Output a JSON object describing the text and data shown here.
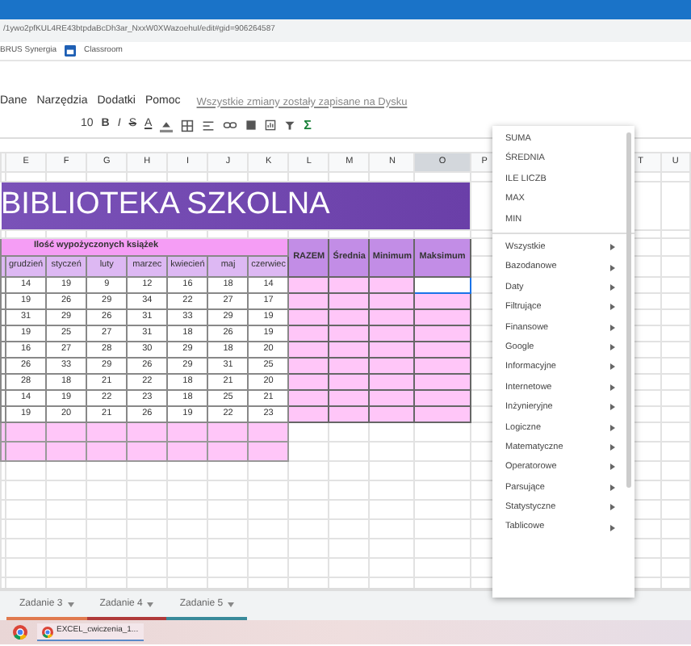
{
  "browser": {
    "url": "/1ywo2pfKUL4RE43btpdaBcDh3ar_NxxW0XWazoehuI/edit#gid=906264587",
    "bookmarks": [
      "BRUS Synergia",
      "Classroom"
    ]
  },
  "menu_bar": {
    "items": [
      "Dane",
      "Narzędzia",
      "Dodatki",
      "Pomoc"
    ],
    "save_status": "Wszystkie zmiany zostały zapisane na Dysku"
  },
  "toolbar": {
    "font_size": "10",
    "formatting": [
      "B",
      "I",
      "S",
      "A"
    ],
    "function_symbol": "Σ"
  },
  "columns": [
    {
      "letter": "E",
      "selected": false
    },
    {
      "letter": "F",
      "selected": false
    },
    {
      "letter": "G",
      "selected": false
    },
    {
      "letter": "H",
      "selected": false
    },
    {
      "letter": "I",
      "selected": false
    },
    {
      "letter": "J",
      "selected": false
    },
    {
      "letter": "K",
      "selected": false
    },
    {
      "letter": "L",
      "selected": false
    },
    {
      "letter": "M",
      "selected": false
    },
    {
      "letter": "N",
      "selected": false
    },
    {
      "letter": "O",
      "selected": true
    },
    {
      "letter": "P",
      "selected": false
    }
  ],
  "right_columns": [
    {
      "letter": "T",
      "selected": false
    },
    {
      "letter": "U",
      "selected": false
    }
  ],
  "sheet": {
    "title": "BIBLIOTEKA SZKOLNA",
    "group_header": "Ilość wypożyczonych książek",
    "months": [
      "grudzień",
      "styczeń",
      "luty",
      "marzec",
      "kwiecień",
      "maj",
      "czerwiec"
    ],
    "stat_headers": [
      "RAZEM",
      "Średnia",
      "Minimum",
      "Maksimum"
    ],
    "rows": [
      {
        "values": [
          "14",
          "19",
          "9",
          "12",
          "16",
          "18",
          "14"
        ],
        "stat_selected": [
          false,
          false,
          false,
          true
        ]
      },
      {
        "values": [
          "19",
          "26",
          "29",
          "34",
          "22",
          "27",
          "17"
        ],
        "stat_selected": [
          false,
          false,
          false,
          false
        ]
      },
      {
        "values": [
          "31",
          "29",
          "26",
          "31",
          "33",
          "29",
          "19"
        ],
        "stat_selected": [
          false,
          false,
          false,
          false
        ]
      },
      {
        "values": [
          "19",
          "25",
          "27",
          "31",
          "18",
          "26",
          "19"
        ],
        "stat_selected": [
          false,
          false,
          false,
          false
        ]
      },
      {
        "values": [
          "16",
          "27",
          "28",
          "30",
          "29",
          "18",
          "20"
        ],
        "stat_selected": [
          false,
          false,
          false,
          false
        ]
      },
      {
        "values": [
          "26",
          "33",
          "29",
          "26",
          "29",
          "31",
          "25"
        ],
        "stat_selected": [
          false,
          false,
          false,
          false
        ]
      },
      {
        "values": [
          "28",
          "18",
          "21",
          "22",
          "18",
          "21",
          "20"
        ],
        "stat_selected": [
          false,
          false,
          false,
          false
        ]
      },
      {
        "values": [
          "14",
          "19",
          "22",
          "23",
          "18",
          "25",
          "21"
        ],
        "stat_selected": [
          false,
          false,
          false,
          false
        ]
      },
      {
        "values": [
          "19",
          "20",
          "21",
          "26",
          "19",
          "22",
          "23"
        ],
        "stat_selected": [
          false,
          false,
          false,
          false
        ]
      }
    ]
  },
  "function_menu": {
    "quick": [
      "SUMA",
      "ŚREDNIA",
      "ILE LICZB",
      "MAX",
      "MIN"
    ],
    "categories": [
      "Wszystkie",
      "Bazodanowe",
      "Daty",
      "Filtrujące",
      "Finansowe",
      "Google",
      "Informacyjne",
      "Internetowe",
      "Inżynieryjne",
      "Logiczne",
      "Matematyczne",
      "Operatorowe",
      "Parsujące",
      "Statystyczne",
      "Tablicowe"
    ]
  },
  "sheet_tabs": [
    {
      "label": "Zadanie 3",
      "color": "#e07a4f"
    },
    {
      "label": "Zadanie 4",
      "color": "#b03a3a"
    },
    {
      "label": "Zadanie 5",
      "color": "#3a8a9a"
    }
  ],
  "taskbar": {
    "window_title": "EXCEL_cwiczenia_1..."
  }
}
